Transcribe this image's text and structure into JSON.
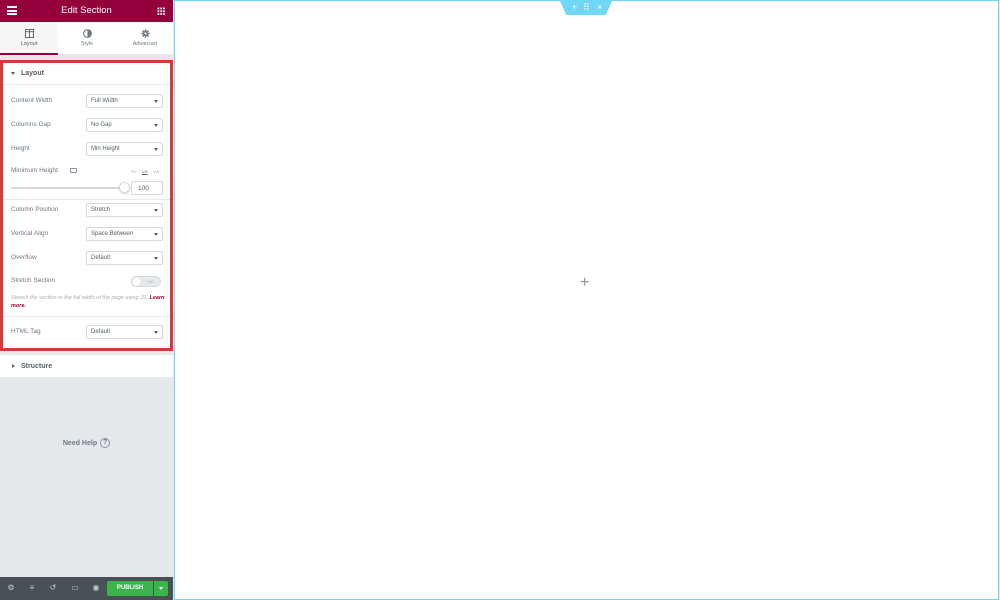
{
  "header": {
    "title": "Edit Section"
  },
  "tabs": [
    {
      "label": "Layout",
      "icon": "layout-icon",
      "active": true
    },
    {
      "label": "Style",
      "icon": "style-icon",
      "active": false
    },
    {
      "label": "Advanced",
      "icon": "gear-icon",
      "active": false
    }
  ],
  "layout_section": {
    "title": "Layout",
    "content_width": {
      "label": "Content Width",
      "value": "Full Width"
    },
    "columns_gap": {
      "label": "Columns Gap",
      "value": "No Gap"
    },
    "height": {
      "label": "Height",
      "value": "Min Height"
    },
    "min_height": {
      "label": "Minimum Height",
      "units": [
        "PX",
        "VH",
        "VW"
      ],
      "active_unit": "VH",
      "value": "100"
    },
    "column_position": {
      "label": "Column Position",
      "value": "Stretch"
    },
    "vertical_align": {
      "label": "Vertical Align",
      "value": "Space Between"
    },
    "overflow": {
      "label": "Overflow",
      "value": "Default"
    },
    "stretch_section": {
      "label": "Stretch Section",
      "toggle_text": "NO",
      "description": "Stretch the section to the full width of the page using JS.",
      "link": "Learn more."
    },
    "html_tag": {
      "label": "HTML Tag",
      "value": "Default"
    }
  },
  "structure_section": {
    "title": "Structure"
  },
  "help": {
    "label": "Need Help",
    "icon": "question-icon"
  },
  "footer": {
    "publish_label": "PUBLISH"
  },
  "canvas": {
    "handle": {
      "add": "+",
      "move": "⠿",
      "close": "×"
    },
    "add_symbol": "+"
  },
  "colors": {
    "brand": "#93003c",
    "publish": "#39b54a",
    "accent": "#71d7f7",
    "highlight": "#d33b3b"
  }
}
